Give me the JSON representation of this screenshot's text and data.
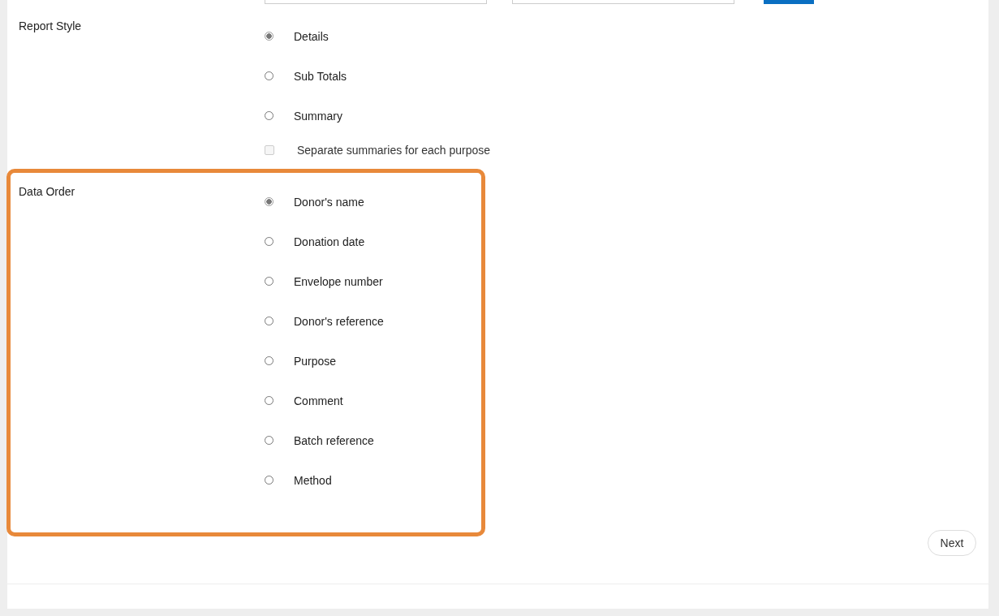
{
  "top_controls": [
    {
      "kind": "field"
    },
    {
      "kind": "field"
    },
    {
      "kind": "button"
    }
  ],
  "sections": [
    {
      "label": "Report Style",
      "highlighted": false,
      "options": [
        {
          "label": "Details",
          "selected": true
        },
        {
          "label": "Sub Totals",
          "selected": false
        },
        {
          "label": "Summary",
          "selected": false
        }
      ],
      "checkbox": {
        "label": "Separate summaries for each purpose",
        "checked": false,
        "disabled": true
      }
    },
    {
      "label": "Data Order",
      "highlighted": true,
      "options": [
        {
          "label": "Donor's name",
          "selected": true
        },
        {
          "label": "Donation date",
          "selected": false
        },
        {
          "label": "Envelope number",
          "selected": false
        },
        {
          "label": "Donor's reference",
          "selected": false
        },
        {
          "label": "Purpose",
          "selected": false
        },
        {
          "label": "Comment",
          "selected": false
        },
        {
          "label": "Batch reference",
          "selected": false
        },
        {
          "label": "Method",
          "selected": false
        }
      ]
    }
  ],
  "next_button": "Next"
}
